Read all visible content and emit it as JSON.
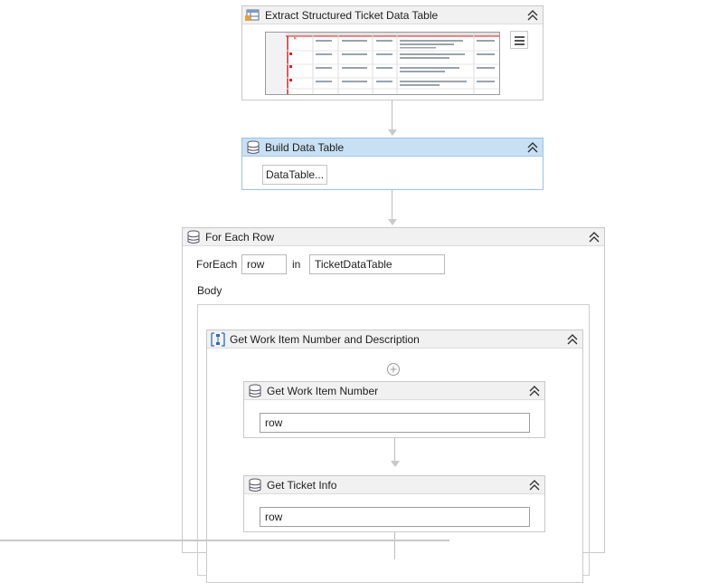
{
  "activities": {
    "extract": {
      "title": "Extract Structured Ticket Data Table"
    },
    "build": {
      "title": "Build Data Table",
      "button_label": "DataTable..."
    },
    "foreach": {
      "title": "For Each Row",
      "foreach_label": "ForEach",
      "item_var": "row",
      "in_label": "in",
      "collection": "TicketDataTable",
      "body_label": "Body"
    },
    "sequence": {
      "title": "Get Work Item Number and Description"
    },
    "work_item": {
      "title": "Get Work Item Number",
      "value": "row"
    },
    "ticket_info": {
      "title": "Get Ticket Info",
      "value": "row"
    }
  },
  "icons": {
    "collapse": "double-chevron-up-icon",
    "add": "plus-circle-icon"
  },
  "colors": {
    "selected_header": "#c7e0f4",
    "header": "#f1f1f1",
    "border": "#c9c9c9"
  }
}
